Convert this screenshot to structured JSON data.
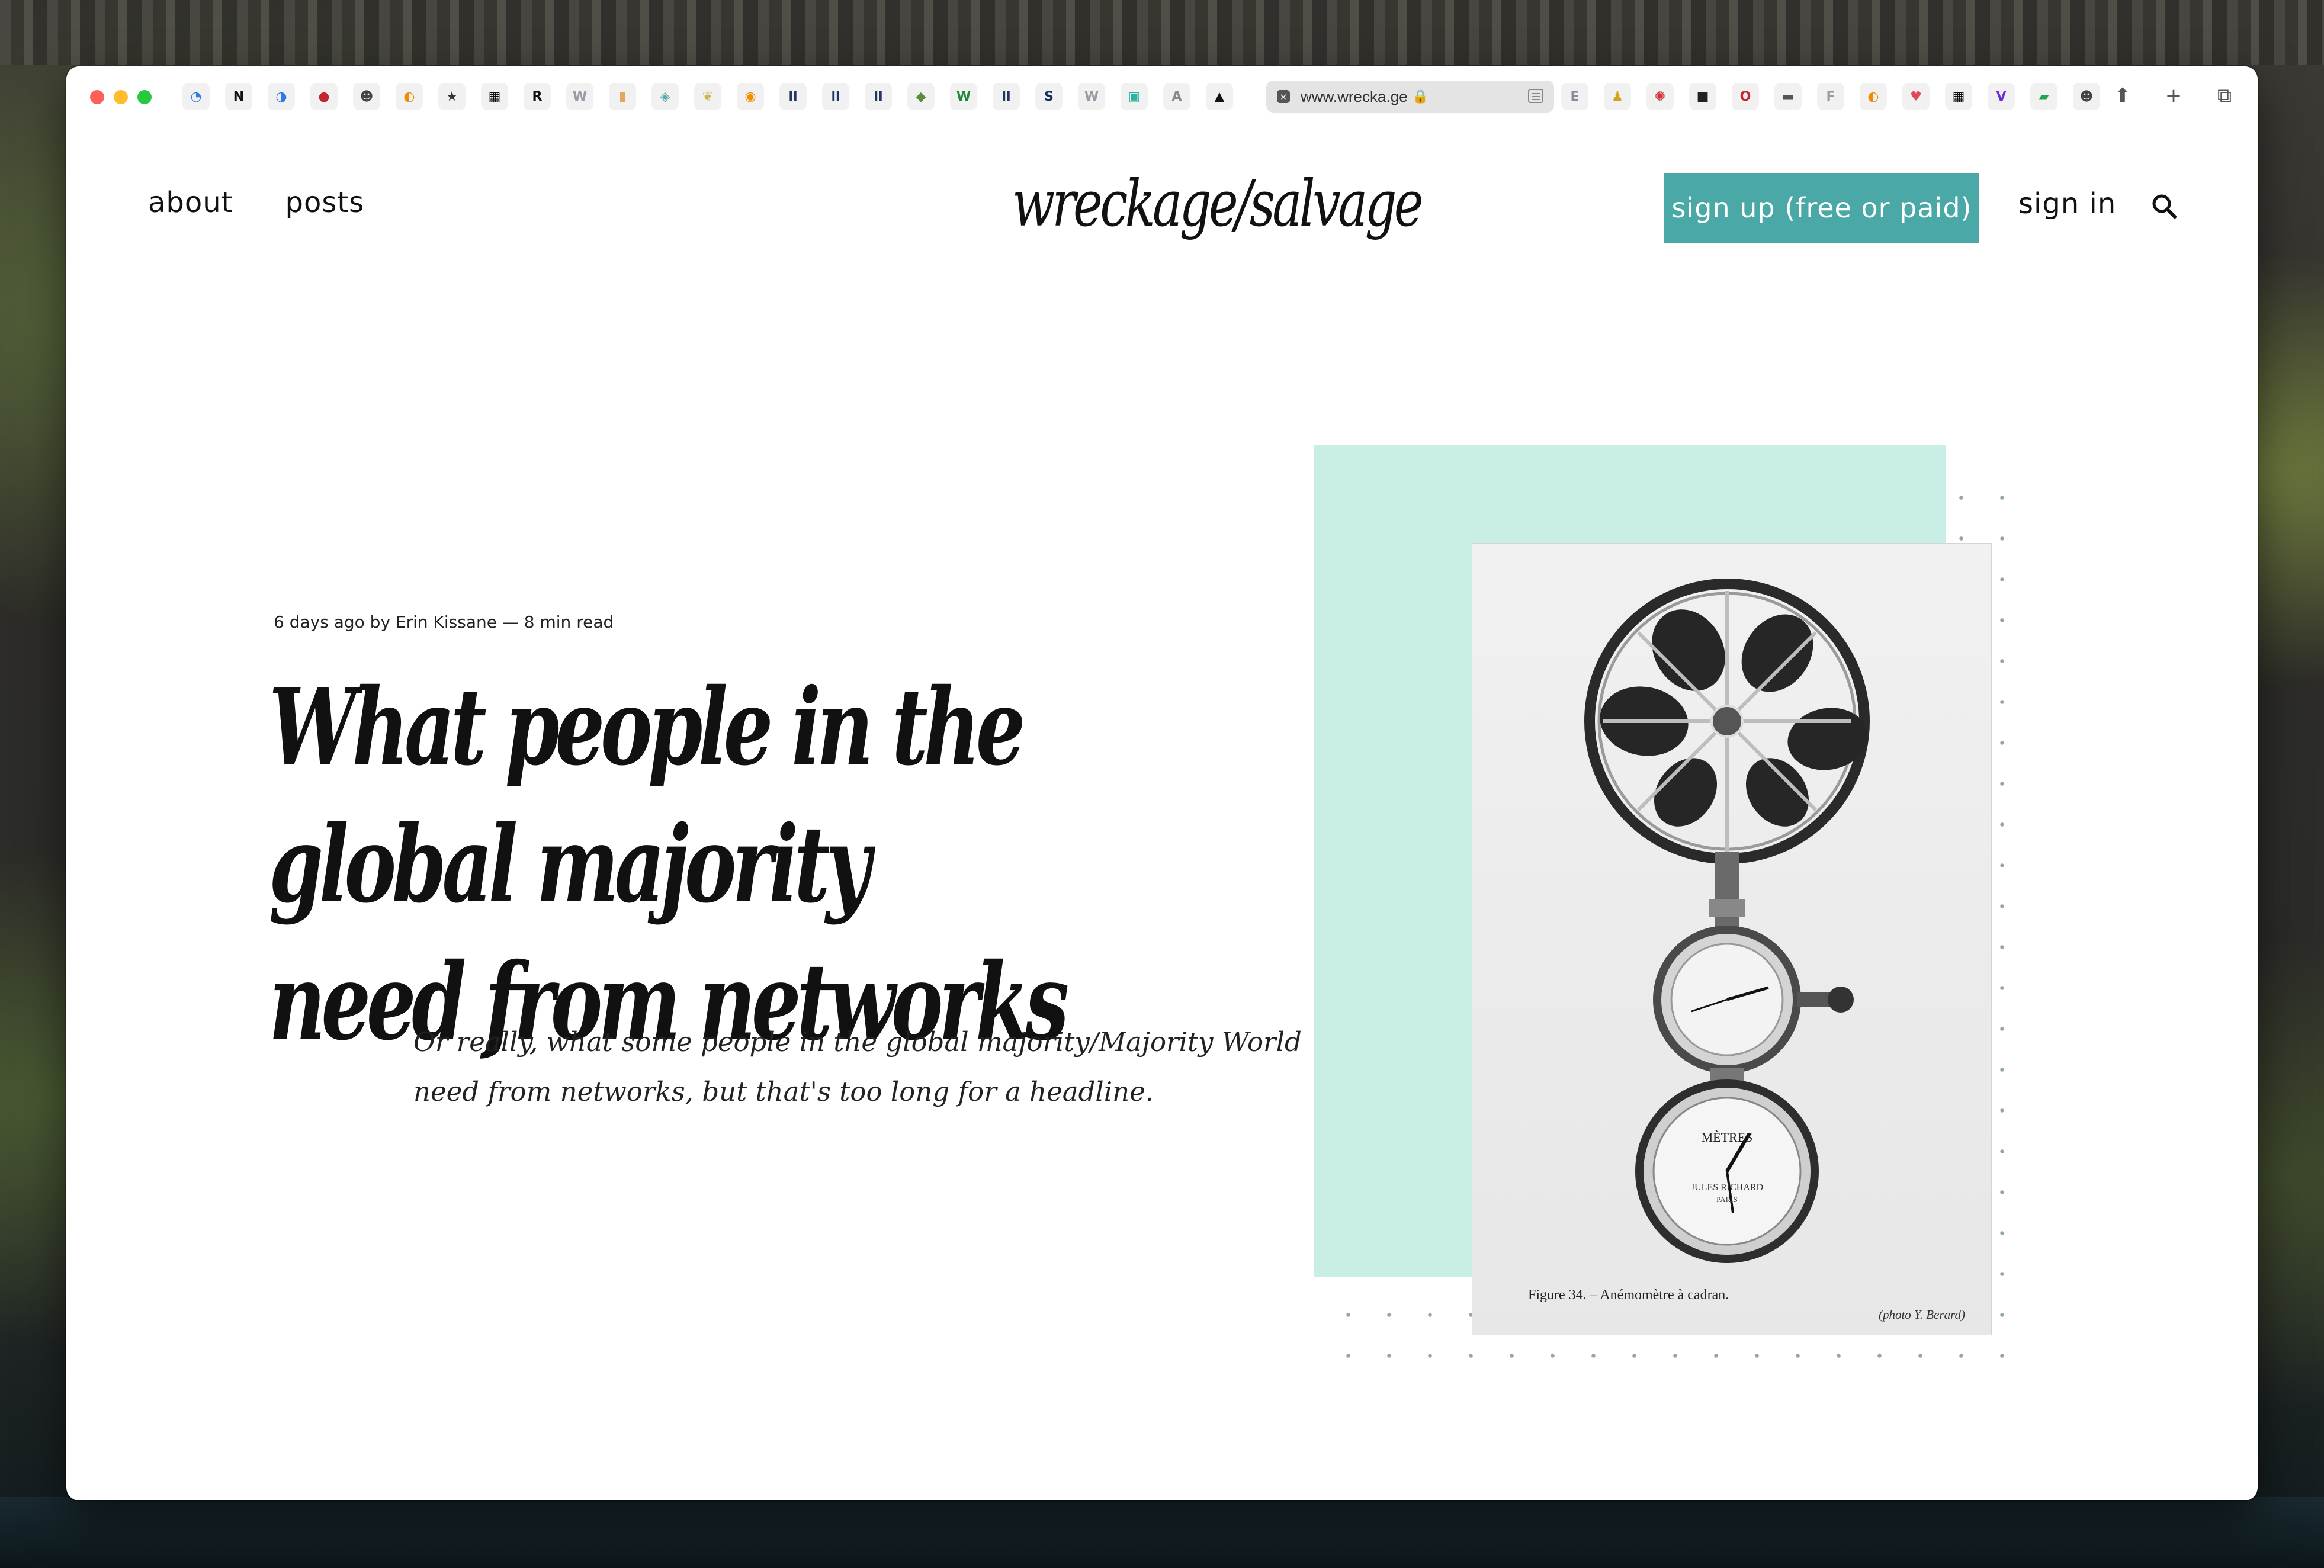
{
  "browser": {
    "address_url": "www.wrecka.ge",
    "tabs_left": [
      {
        "icon": "loading-ring-icon",
        "color": "#2d7be5"
      },
      {
        "icon": "notion-icon",
        "color": "#111111"
      },
      {
        "icon": "pocket-lock-icon",
        "color": "#2d7be5"
      },
      {
        "icon": "record-icon",
        "color": "#c1272d"
      },
      {
        "icon": "person-icon",
        "color": "#444444"
      },
      {
        "icon": "rainbow-icon",
        "color": "#f08c00"
      },
      {
        "icon": "star-badge-icon",
        "color": "#333333"
      },
      {
        "icon": "clapper-icon",
        "color": "#111111"
      },
      {
        "icon": "r-icon",
        "color": "#111111"
      },
      {
        "icon": "w-icon",
        "color": "#9a9aa6"
      },
      {
        "icon": "jar-icon",
        "color": "#e0a860"
      },
      {
        "icon": "lock-shield-icon",
        "color": "#5aa8a8"
      },
      {
        "icon": "leaf-icon",
        "color": "#c4b94a"
      },
      {
        "icon": "firefox-icon",
        "color": "#f08c00"
      },
      {
        "icon": "bars-icon",
        "color": "#223366"
      },
      {
        "icon": "bars-icon",
        "color": "#223366"
      },
      {
        "icon": "bars-icon",
        "color": "#223366"
      },
      {
        "icon": "frog-icon",
        "color": "#5d8c3a"
      },
      {
        "icon": "w-green-icon",
        "color": "#1f8a3a"
      },
      {
        "icon": "bars-icon",
        "color": "#223366"
      },
      {
        "icon": "s-icon",
        "color": "#1a2a55"
      },
      {
        "icon": "w-icon",
        "color": "#9a9aa6"
      },
      {
        "icon": "monitor-icon",
        "color": "#2bb3a3"
      },
      {
        "icon": "a-icon",
        "color": "#8a8a8a"
      },
      {
        "icon": "a-triangle-icon",
        "color": "#111111"
      }
    ],
    "tabs_right": [
      {
        "icon": "e-icon",
        "color": "#8a8a9a"
      },
      {
        "icon": "bell-icon",
        "color": "#d4a21b"
      },
      {
        "icon": "swirl-icon",
        "color": "#d0333c"
      },
      {
        "icon": "dark-square-icon",
        "color": "#222222"
      },
      {
        "icon": "red-o-icon",
        "color": "#c1272d"
      },
      {
        "icon": "drive-icon",
        "color": "#555555"
      },
      {
        "icon": "f-icon",
        "color": "#9a9aa6"
      },
      {
        "icon": "rainbow-icon",
        "color": "#f08c00"
      },
      {
        "icon": "pocket-icon",
        "color": "#e0475a"
      },
      {
        "icon": "clapper-icon",
        "color": "#111111"
      },
      {
        "icon": "v-icon",
        "color": "#6b2bd6"
      },
      {
        "icon": "chat-icon",
        "color": "#1fa84f"
      },
      {
        "icon": "person-icon",
        "color": "#444444"
      }
    ]
  },
  "nav": {
    "about": "about",
    "posts": "posts"
  },
  "logo": "wreckage/salvage",
  "header": {
    "signup": "sign up (free or paid)",
    "signin": "sign in"
  },
  "article": {
    "meta": "6 days ago by Erin Kissane — 8 min read",
    "title_line1": "What people in the global majority",
    "title_line2": "need from networks",
    "dek_line1": "Or really, what some people in the global majority/Majority World",
    "dek_line2": "need from networks, but that's too long for a headline."
  },
  "hero": {
    "caption": "Figure 34. – Anémomètre à cadran.",
    "credit": "(photo Y. Berard)",
    "dial_text_1": "MÈTRES",
    "dial_text_2": "JULES RICHARD",
    "dial_text_3": "PARIS",
    "accent_color": "#c9eee5"
  },
  "colors": {
    "signup_bg": "#4aa9a6",
    "text": "#111111"
  }
}
